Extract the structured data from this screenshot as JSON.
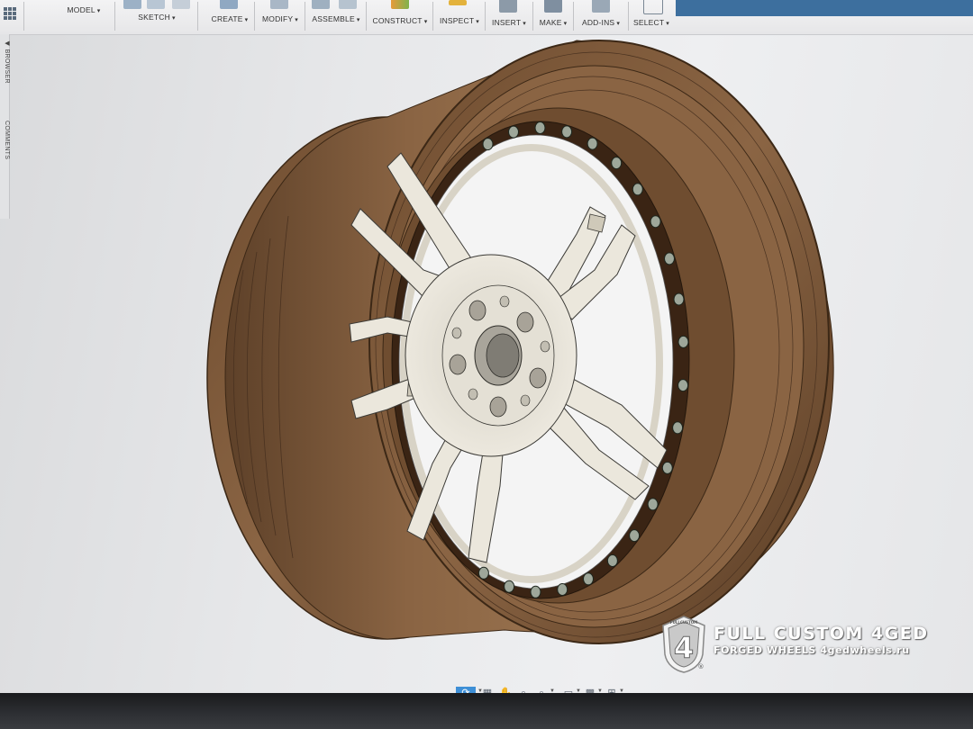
{
  "toolbar": {
    "workspace_label": "MODEL",
    "groups": [
      {
        "label": "SKETCH"
      },
      {
        "label": "CREATE"
      },
      {
        "label": "MODIFY"
      },
      {
        "label": "ASSEMBLE"
      },
      {
        "label": "CONSTRUCT"
      },
      {
        "label": "INSPECT"
      },
      {
        "label": "INSERT"
      },
      {
        "label": "MAKE"
      },
      {
        "label": "ADD-INS"
      },
      {
        "label": "SELECT"
      }
    ],
    "caret": "▾",
    "accent_color": "#3d6f9e"
  },
  "side_panel": {
    "browser_label": "BROWSER",
    "comments_label": "COMMENTS"
  },
  "canvas": {
    "model": "wheel",
    "rim_color": "#7a5636",
    "spoke_color": "#ebe7dc",
    "background_color": "#e9eaec"
  },
  "watermark": {
    "title": "FULL CUSTOM 4GED",
    "subtitle": "FORGED WHEELS 4gedwheels.ru",
    "logo_text": "4",
    "logo_banner": "FULLCUSTOM",
    "registered": "®"
  },
  "navbar": {
    "icons": [
      "orbit-icon",
      "look-at-icon",
      "pan-icon",
      "zoom-icon",
      "zoom-window-icon",
      "display-settings-icon",
      "grid-icon",
      "viewports-icon"
    ]
  }
}
